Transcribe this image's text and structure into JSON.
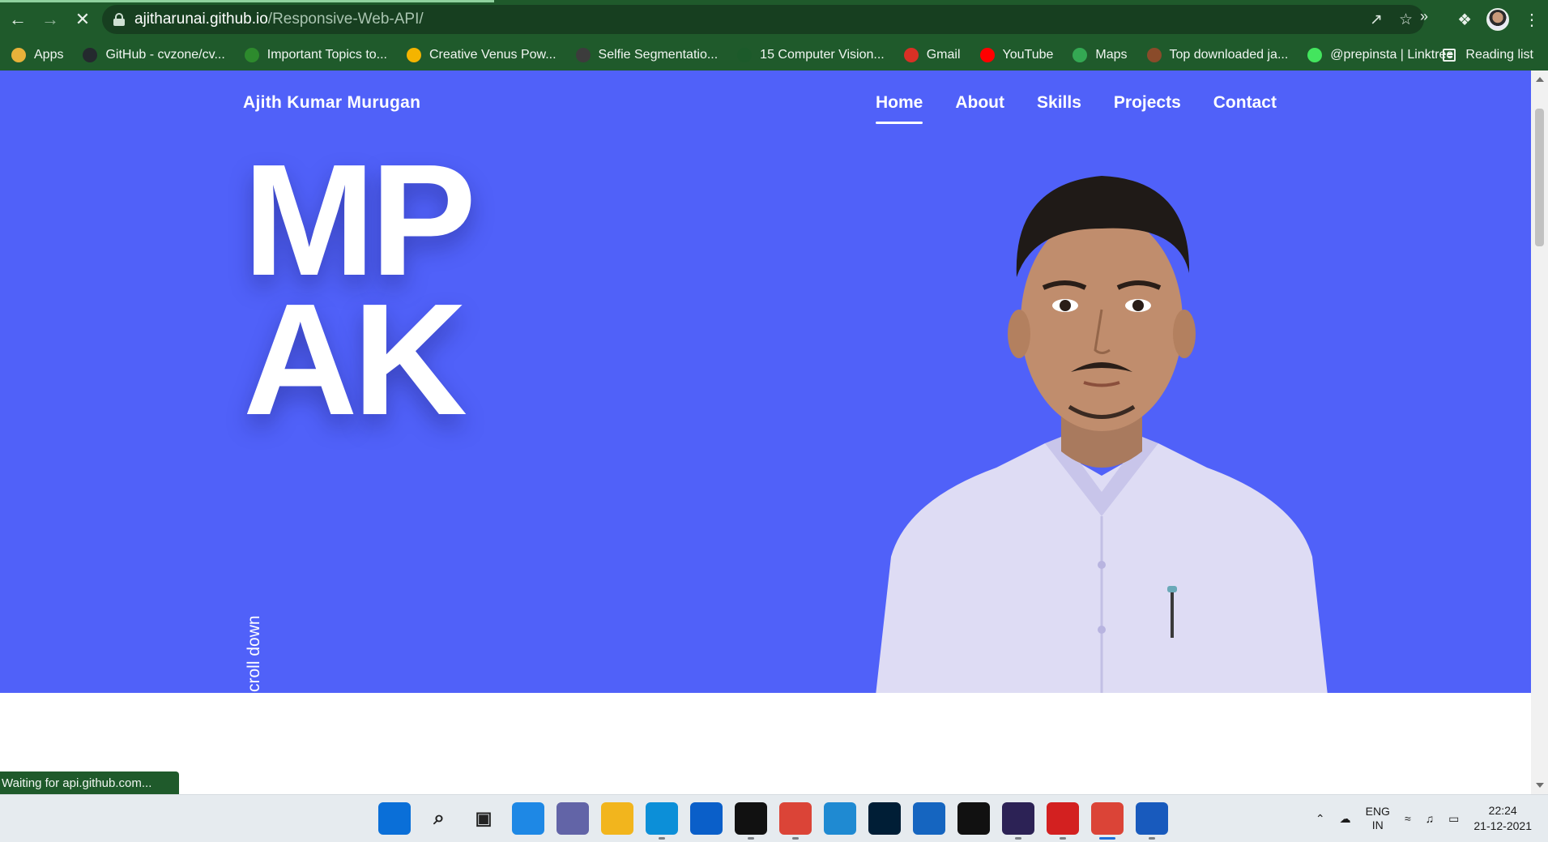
{
  "browser": {
    "url_host": "ajitharunai.github.io",
    "url_path": "/Responsive-Web-API/",
    "bookmarks": [
      {
        "label": "Apps",
        "icon": "apps-grid-icon",
        "color": "#e8b23a"
      },
      {
        "label": "GitHub - cvzone/cv...",
        "icon": "github-icon",
        "color": "#24292e"
      },
      {
        "label": "Important Topics to...",
        "icon": "site-icon",
        "color": "#2d8a2d"
      },
      {
        "label": "Creative Venus Pow...",
        "icon": "google-drive-icon",
        "color": "#f4b400"
      },
      {
        "label": "Selfie Segmentatio...",
        "icon": "globe-icon",
        "color": "#3c3c3c"
      },
      {
        "label": "15 Computer Vision...",
        "icon": "site-icon",
        "color": "#1c5a2a"
      },
      {
        "label": "Gmail",
        "icon": "gmail-icon",
        "color": "#d93025"
      },
      {
        "label": "YouTube",
        "icon": "youtube-icon",
        "color": "#ff0000"
      },
      {
        "label": "Maps",
        "icon": "maps-icon",
        "color": "#34a853"
      },
      {
        "label": "Top downloaded ja...",
        "icon": "site-icon",
        "color": "#8a4b2a"
      },
      {
        "label": "@prepinsta | Linktree",
        "icon": "linktree-icon",
        "color": "#43e55e"
      }
    ],
    "more_label": "»",
    "reading_list": "Reading list",
    "status_text": "Waiting for api.github.com..."
  },
  "site": {
    "name": "Ajith Kumar Murugan",
    "nav": [
      {
        "label": "Home",
        "active": true
      },
      {
        "label": "About",
        "active": false
      },
      {
        "label": "Skills",
        "active": false
      },
      {
        "label": "Projects",
        "active": false
      },
      {
        "label": "Contact",
        "active": false
      }
    ],
    "hero_line1": "MP",
    "hero_line2": "AK",
    "scroll_label": "Scroll down",
    "hero_bg": "#5061f9"
  },
  "taskbar": {
    "apps": [
      {
        "name": "start",
        "icon": "windows-start-icon",
        "color": "#0a6fd8"
      },
      {
        "name": "search",
        "icon": "search-icon",
        "color": "#2b2b2b"
      },
      {
        "name": "task-view",
        "icon": "task-view-icon",
        "color": "#2b2b2b"
      },
      {
        "name": "widgets",
        "icon": "widgets-icon",
        "color": "#1e88e5"
      },
      {
        "name": "chat",
        "icon": "chat-icon",
        "color": "#6264a7"
      },
      {
        "name": "file-explorer",
        "icon": "folder-icon",
        "color": "#f2b51d"
      },
      {
        "name": "edge",
        "icon": "edge-icon",
        "color": "#0c8fd8"
      },
      {
        "name": "app",
        "icon": "app-icon",
        "color": "#0a5fc9"
      },
      {
        "name": "pycharm",
        "icon": "pycharm-icon",
        "color": "#111111"
      },
      {
        "name": "chrome",
        "icon": "chrome-icon",
        "color": "#db4437"
      },
      {
        "name": "vscode",
        "icon": "vscode-icon",
        "color": "#1f8ad2"
      },
      {
        "name": "photoshop",
        "icon": "photoshop-icon",
        "color": "#001e36"
      },
      {
        "name": "store",
        "icon": "store-icon",
        "color": "#1565c0"
      },
      {
        "name": "intellij",
        "icon": "intellij-icon",
        "color": "#111111"
      },
      {
        "name": "eclipse",
        "icon": "eclipse-icon",
        "color": "#2c2255"
      },
      {
        "name": "acrobat",
        "icon": "acrobat-icon",
        "color": "#d32020"
      },
      {
        "name": "chrome-profile",
        "icon": "chrome-profile-icon",
        "color": "#db4437"
      },
      {
        "name": "word",
        "icon": "word-icon",
        "color": "#185abd"
      }
    ],
    "language": "ENG",
    "region": "IN",
    "time": "22:24",
    "date": "21-12-2021"
  }
}
